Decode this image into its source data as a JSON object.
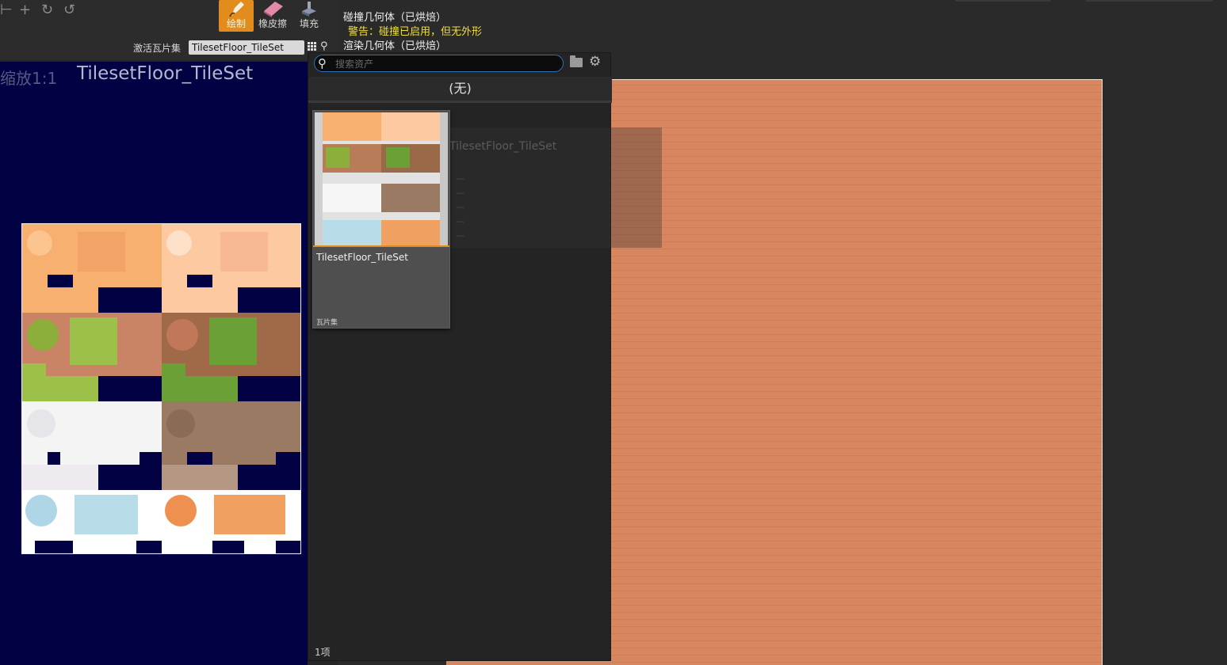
{
  "toolbar": {
    "paint_label": "绘制",
    "erase_label": "橡皮擦",
    "fill_label": "填充",
    "active_tileset_label": "激活瓦片集",
    "active_tileset_value": "TilesetFloor_TileSet"
  },
  "left_viewport": {
    "zoom_label": "缩放1:1",
    "title": "TilesetFloor_TileSet"
  },
  "status": {
    "collision_line": "碰撞几何体（已烘焙）",
    "warning_line": "警告：碰撞已启用，但无外形",
    "render_line": "渲染几何体（已烘焙）"
  },
  "picker": {
    "search_placeholder": "搜索资产",
    "none_option": "(无)",
    "asset": {
      "name": "TilesetFloor_TileSet",
      "type": "瓦片集"
    },
    "count_label": "1项"
  },
  "colors": {
    "accent": "#e38c1e",
    "viewport_bg": "#020144",
    "canvas_fill": "#d8865f",
    "warning": "#f2df3a",
    "search_border": "#2f6fb7"
  },
  "icons": {
    "paint": "brush-icon",
    "erase": "eraser-icon",
    "fill": "fill-bucket-icon",
    "search": "search-icon",
    "folder": "folder-icon",
    "settings": "gear-icon",
    "grid": "grid-icon"
  }
}
